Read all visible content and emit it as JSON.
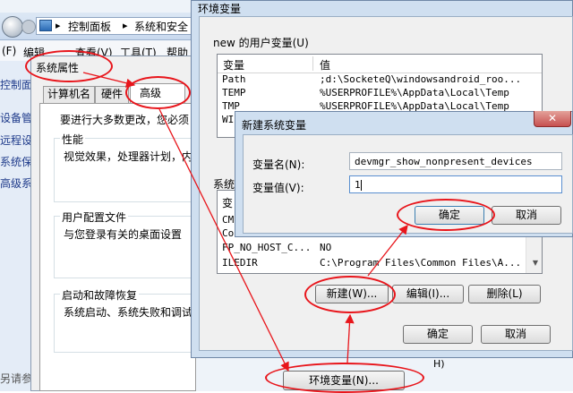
{
  "explorer": {
    "address": {
      "crumb1": "控制面板",
      "crumb2": "系统和安全"
    },
    "menu": {
      "file": "(F)",
      "edit": "编辑",
      "view": "查看(V)",
      "tools": "工具(T)",
      "help": "帮助"
    },
    "sidebar": [
      "控制面",
      "设备管",
      "远程设",
      "系统保",
      "高级系"
    ],
    "bottom_text": "另请参"
  },
  "sysprops": {
    "title": "系统属性",
    "tabs": {
      "computer_name": "计算机名",
      "hardware": "硬件",
      "advanced": "高级"
    },
    "intro": "要进行大多数更改，您必须",
    "groups": [
      {
        "title": "性能",
        "desc": "视觉效果，处理器计划，内"
      },
      {
        "title": "用户配置文件",
        "desc": "与您登录有关的桌面设置"
      },
      {
        "title": "启动和故障恢复",
        "desc": "系统启动、系统失败和调试"
      }
    ],
    "env_button": "环境变量(N)..."
  },
  "envvars": {
    "title": "环境变量",
    "user_group_label": "new 的用户变量(U)",
    "table_headers": {
      "var": "变量",
      "value": "值"
    },
    "user_vars": [
      {
        "name": "Path",
        "value": ";d:\\SocketeQ\\windowsandroid_roo..."
      },
      {
        "name": "TEMP",
        "value": "%USERPROFILE%\\AppData\\Local\\Temp"
      },
      {
        "name": "TMP",
        "value": "%USERPROFILE%\\AppData\\Local\\Temp"
      },
      {
        "name": "WIN",
        "value": ""
      }
    ],
    "sys_group_label": "系统",
    "sys_vars": [
      {
        "name": "变",
        "value": ""
      },
      {
        "name": "CM",
        "value": ""
      },
      {
        "name": "Co",
        "value": ""
      },
      {
        "name": "FP_NO_HOST_C...",
        "value": "NO"
      },
      {
        "name": "ILEDIR",
        "value": "C:\\Program Files\\Common Files\\A..."
      }
    ],
    "buttons": {
      "new": "新建(W)...",
      "edit": "编辑(I)...",
      "delete": "删除(L)",
      "ok": "确定",
      "cancel": "取消"
    },
    "right_edge_char": "H)"
  },
  "newvar": {
    "title": "新建系统变量",
    "close_glyph": "✕",
    "name_label": "变量名(N):",
    "name_value": "devmgr_show_nonpresent_devices",
    "value_label": "变量值(V):",
    "value_value": "1",
    "ok": "确定",
    "cancel": "取消"
  },
  "colors": {
    "annotation": "#e8151b",
    "title_bar": "#b9d1ea",
    "close_red": "#c75050"
  }
}
